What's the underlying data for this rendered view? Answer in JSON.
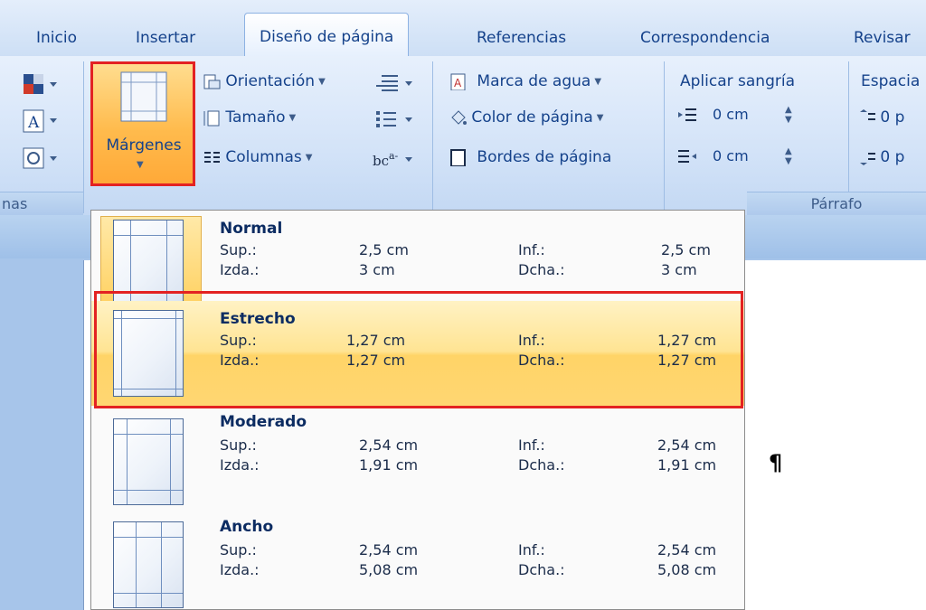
{
  "tabs": [
    {
      "label": "Inicio"
    },
    {
      "label": "Insertar"
    },
    {
      "label": "Diseño de página"
    },
    {
      "label": "Referencias"
    },
    {
      "label": "Correspondencia"
    },
    {
      "label": "Revisar"
    }
  ],
  "ribbon": {
    "themes_footer": "nas",
    "margins_label": "Márgenes",
    "orientation": "Orientación",
    "size": "Tamaño",
    "columns": "Columnas",
    "watermark": "Marca de agua",
    "page_color": "Color de página",
    "page_borders": "Bordes de página",
    "indent_label": "Aplicar sangría",
    "indent_left": "0 cm",
    "indent_right": "0 cm",
    "spacing_label": "Espacia",
    "spacing_before": "0 p",
    "spacing_after": "0 p",
    "paragraph_footer": "Párrafo"
  },
  "margins_menu": {
    "options": [
      {
        "name": "Normal",
        "sup_label": "Sup.:",
        "sup": "2,5 cm",
        "inf_label": "Inf.:",
        "inf": "2,5 cm",
        "izda_label": "Izda.:",
        "izda": "3 cm",
        "dcha_label": "Dcha.:",
        "dcha": "3 cm"
      },
      {
        "name": "Estrecho",
        "sup_label": "Sup.:",
        "sup": "1,27 cm",
        "inf_label": "Inf.:",
        "inf": "1,27 cm",
        "izda_label": "Izda.:",
        "izda": "1,27 cm",
        "dcha_label": "Dcha.:",
        "dcha": "1,27 cm"
      },
      {
        "name": "Moderado",
        "sup_label": "Sup.:",
        "sup": "2,54 cm",
        "inf_label": "Inf.:",
        "inf": "2,54 cm",
        "izda_label": "Izda.:",
        "izda": "1,91 cm",
        "dcha_label": "Dcha.:",
        "dcha": "1,91 cm"
      },
      {
        "name": "Ancho",
        "sup_label": "Sup.:",
        "sup": "2,54 cm",
        "inf_label": "Inf.:",
        "inf": "2,54 cm",
        "izda_label": "Izda.:",
        "izda": "5,08 cm",
        "dcha_label": "Dcha.:",
        "dcha": "5,08 cm"
      }
    ]
  },
  "document": {
    "pilcrow": "¶"
  },
  "colors": {
    "highlight": "#e32222",
    "accent": "#15428b",
    "selected": "#ffd467"
  }
}
